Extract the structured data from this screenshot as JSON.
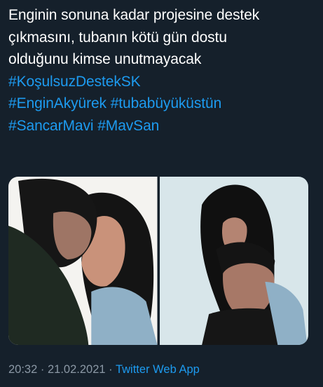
{
  "tweet": {
    "lines": [
      "Enginin sonuna kadar projesine destek",
      "çıkmasını, tubanın kötü gün dostu",
      "olduğunu kimse unutmayacak"
    ],
    "hashtags": [
      [
        "#KoşulsuzDestekSK"
      ],
      [
        "#EnginAkyürek",
        "#tubabüyüküstün"
      ],
      [
        "#SancarMavi",
        "#MavSan"
      ]
    ]
  },
  "media": {
    "photos": [
      {
        "name": "photo-1",
        "background": "#f4f3f0"
      },
      {
        "name": "photo-2",
        "background": "#d8e6ea"
      }
    ]
  },
  "meta": {
    "time": "20:32",
    "separator": "·",
    "date": "21.02.2021",
    "app": "Twitter Web App"
  },
  "colors": {
    "background": "#15202b",
    "text": "#ffffff",
    "link": "#1d9bf0",
    "muted": "#8b98a5"
  }
}
